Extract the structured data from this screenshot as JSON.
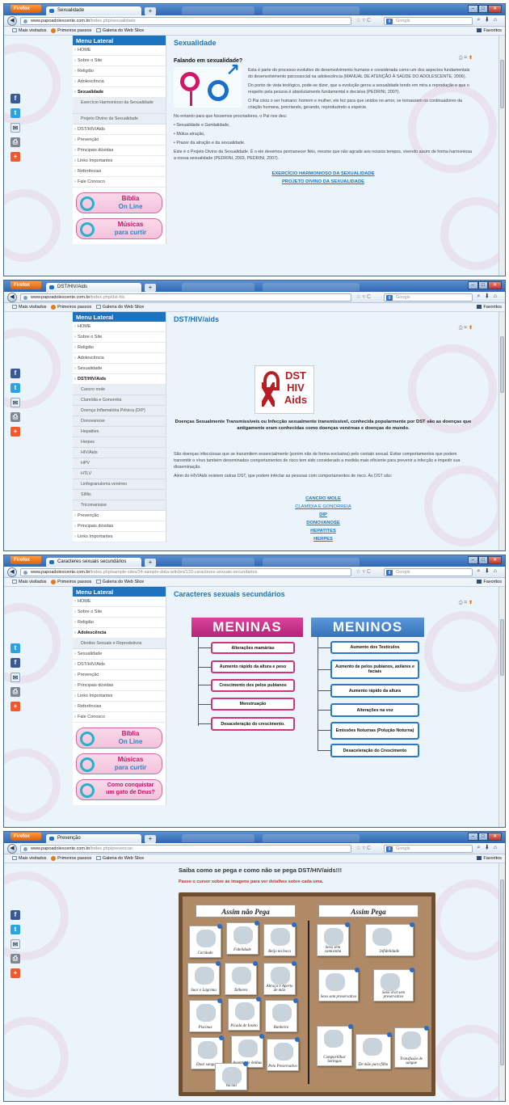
{
  "browser": {
    "firefox_label": "Firefox",
    "bookmarks": {
      "mais_visitados": "Mais visitados",
      "primeiros_passos": "Primeiros passos",
      "galeria": "Galeria do Web Slice"
    },
    "favorites": "Favoritos",
    "search_placeholder": "Google"
  },
  "menu": {
    "heading": "Menu Lateral",
    "home": "HOME",
    "sobre": "Sobre o Site",
    "religiao": "Religião",
    "adolescencia": "Adolescência",
    "sexualidade": "Sexualidade",
    "dst": "DST/HIV/Aids",
    "prevencao": "Prevenção",
    "duvidas": "Principais dúvidas",
    "links": "Links Importantes",
    "referencias": "Referências",
    "fale": "Fale Conosco"
  },
  "banners": {
    "biblia_a": "Bíblia",
    "biblia_b": "On Line",
    "musicas_a": "Músicas",
    "musicas_b": "para curtir",
    "conquistar_a": "Como conquistar",
    "conquistar_b": "um gato de Deus?"
  },
  "s1": {
    "tab": "Sexualidade",
    "url_host": "www.papoadolescente.com.br",
    "url_path": "/index.php/sexualidade",
    "title": "Sexualidade",
    "heading": "Falando em sexualidade?",
    "p1": "Esta é parte do processo evolutivo do desenvolvimento humano e considerada como um dos aspectos fundamentais do desenvolvimento psicossocial na adolescência (MANUAL DE ATENÇÃO À SAÚDE DO ADOLESCENTE, 2006).",
    "p2": "Do ponto de vista teológico, pode-se dizer, que a evolução gerou a sexualidade tendo em mira a reprodução e que o respeito pela pessoa é absolutamente fundamental e decisiva (PEDRINI, 2007).",
    "p3": "O Pai criou o ser humano: homem e mulher, ele fez para que unidos no amor, se tornassem os continuadores da criação humana, procriando, gerando, reproduzindo a espécie.",
    "p4": "No entanto para que fossemos procriadores, o Pai nos deu:",
    "b1": "• Sexualidade e Genitalidade,",
    "b2": "• Mútua atração,",
    "b3": "• Prazer da atração e da sexualidade.",
    "p5": "Este é o Projeto Divino da Sexualidade. É o ele devemos permanecer fiéis, mesme que não agrade aos nossos tempos, vivendo assim de forma harmoniosa a nossa sexualidade (PEDRINI, 2003, PEDRINI, 2007).",
    "link1": "EXERCÍCIO HARMONIOSO DA SEXUALIDADE",
    "link2": "PROJETO DIVINO DA SEXUALIDADE",
    "sub1": "Exercício Harmonioso da Sexualidade",
    "sub2": "Projeto Divino da Sexualidade"
  },
  "s2": {
    "tab": "DST/HIV/Aids",
    "url_host": "www.papoadolescente.com.br",
    "url_path": "/index.php/dst-hiv",
    "title": "DST/HIV/aids",
    "menu_dst": "DST/HIV/Aids",
    "logo_text": "DST HIV Aids",
    "caption": "Doenças Sexualmente Transmissíveis ou Infecção sexualmente transmissível, conhecida popularmente por DST são as doenças que antigamente eram conhecidas como doenças venéreas e doenças do mundo.",
    "p1": "São doenças infecciosas que se transmitem essencialmente (porém não de forma exclusiva) pelo contato sexual. Evitar comportamentos que podem transmitir o vírus também denominados comportamentos de risco tem sido considerado a medida mais eficiente para prevenir a infecção e impedir sua disseminação.",
    "p2": "Além do HIV/Aids existem outras DST, que podem infectar as pessoas com comportamentos de risco. As DST são:",
    "subs": [
      "Cancro mole",
      "Clamídia e Gonorréia",
      "Doença Inflamatória Pélvica (DIP)",
      "Donovanose",
      "Hepatites",
      "Herpes",
      "HIV/Aids",
      "HPV",
      "HTLV",
      "Linfogranuloma venéreo",
      "Sífilis",
      "Tricomaníase"
    ],
    "links": [
      "CANCRO MOLE",
      "CLAMÍDIA E GONORREIA",
      "DIP",
      "DONOVANOSE",
      "HEPATITES",
      "HERPES"
    ]
  },
  "s3": {
    "tab": "Caracteres sexuais secundários",
    "url_host": "www.papoadolescente.com.br",
    "url_path": "/index.php/sample-sites/34-sample-data-articles/133-caracteres-sexuais-secundarios",
    "title": "Caracteres sexuais secundários",
    "sub1": "Direitos Sexuais e Reprodutivos",
    "meninas": "MENINAS",
    "meninos": "MENINOS",
    "girls": [
      "Alterações mamárias",
      "Aumento rápido da altura e peso",
      "Crescimento dos pelos pubianos",
      "Menstruação",
      "Desaceleração do crescimento."
    ],
    "boys": [
      "Aumento dos Testículos",
      "Aumento de pelos pubianos, axilares e faciais",
      "Aumento rápido da altura",
      "Alterações na voz",
      "Emissões Noturnas (Polução Noturna)",
      "Desaceleração do Crescimento"
    ]
  },
  "s4": {
    "tab": "Prevenção",
    "url_host": "www.papoadolescente.com.br",
    "url_path": "/index.php/prevencao",
    "heading": "Saiba como se pega e como não se pega DST/HIV/aids!!!",
    "sub": "Passe o cursor sobre as imagens para ver detalhes sobre cada uma.",
    "assim_nao": "Assim não Pega",
    "assim_pega": "Assim Pega",
    "nao_pega": [
      "Caridade",
      "Fidelidade",
      "Beijo na boca",
      "Suor e Lágrima",
      "Talheres",
      "Abraço e Aperto de mão",
      "Piscinas",
      "Picada de Inseto",
      "Banheiro",
      "Doar sangue",
      "Assento de ônibus",
      "Pelo Preservativo",
      "Vacina"
    ],
    "pega": [
      "Sexo sem camisinha",
      "Infidelidade",
      "Sexo sem preservativo",
      "Sexo oral sem preservativo",
      "Compartilhar Seringas",
      "De mãe para filho",
      "Transfusão de sangue"
    ]
  }
}
